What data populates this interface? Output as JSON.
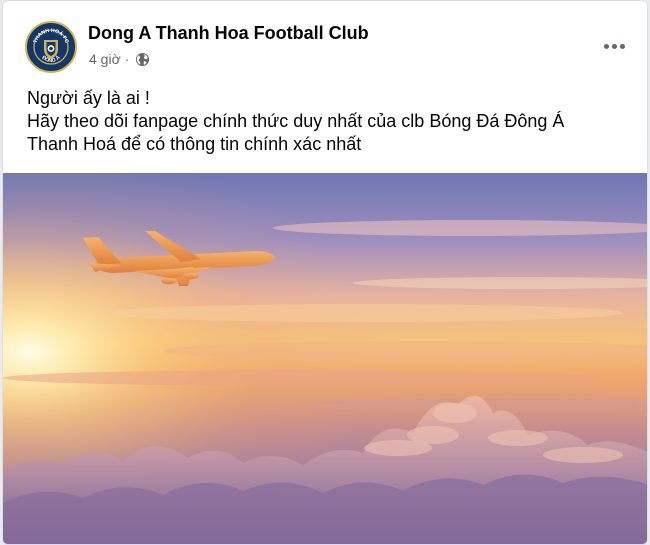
{
  "post": {
    "page_name": "Dong A Thanh Hoa Football Club",
    "timestamp": "4 giờ",
    "separator": "·",
    "privacy_icon": "globe-icon",
    "more_icon": "more-options-icon",
    "text_lines": [
      "Người ấy là ai !",
      "Hãy theo dõi fanpage chính thức duy nhất của clb Bóng Đá Đông Á",
      "Thanh Hoá để có thông tin chính xác nhất"
    ],
    "image_subject": "airplane-at-sunset-above-clouds"
  },
  "avatar": {
    "logo_text_top": "THANH HOÁ FC",
    "logo_text_bottom": "ĐÔNG Á"
  },
  "colors": {
    "text_primary": "#050505",
    "text_secondary": "#65676b",
    "logo_blue": "#12386b",
    "logo_gold": "#d7b24a"
  }
}
